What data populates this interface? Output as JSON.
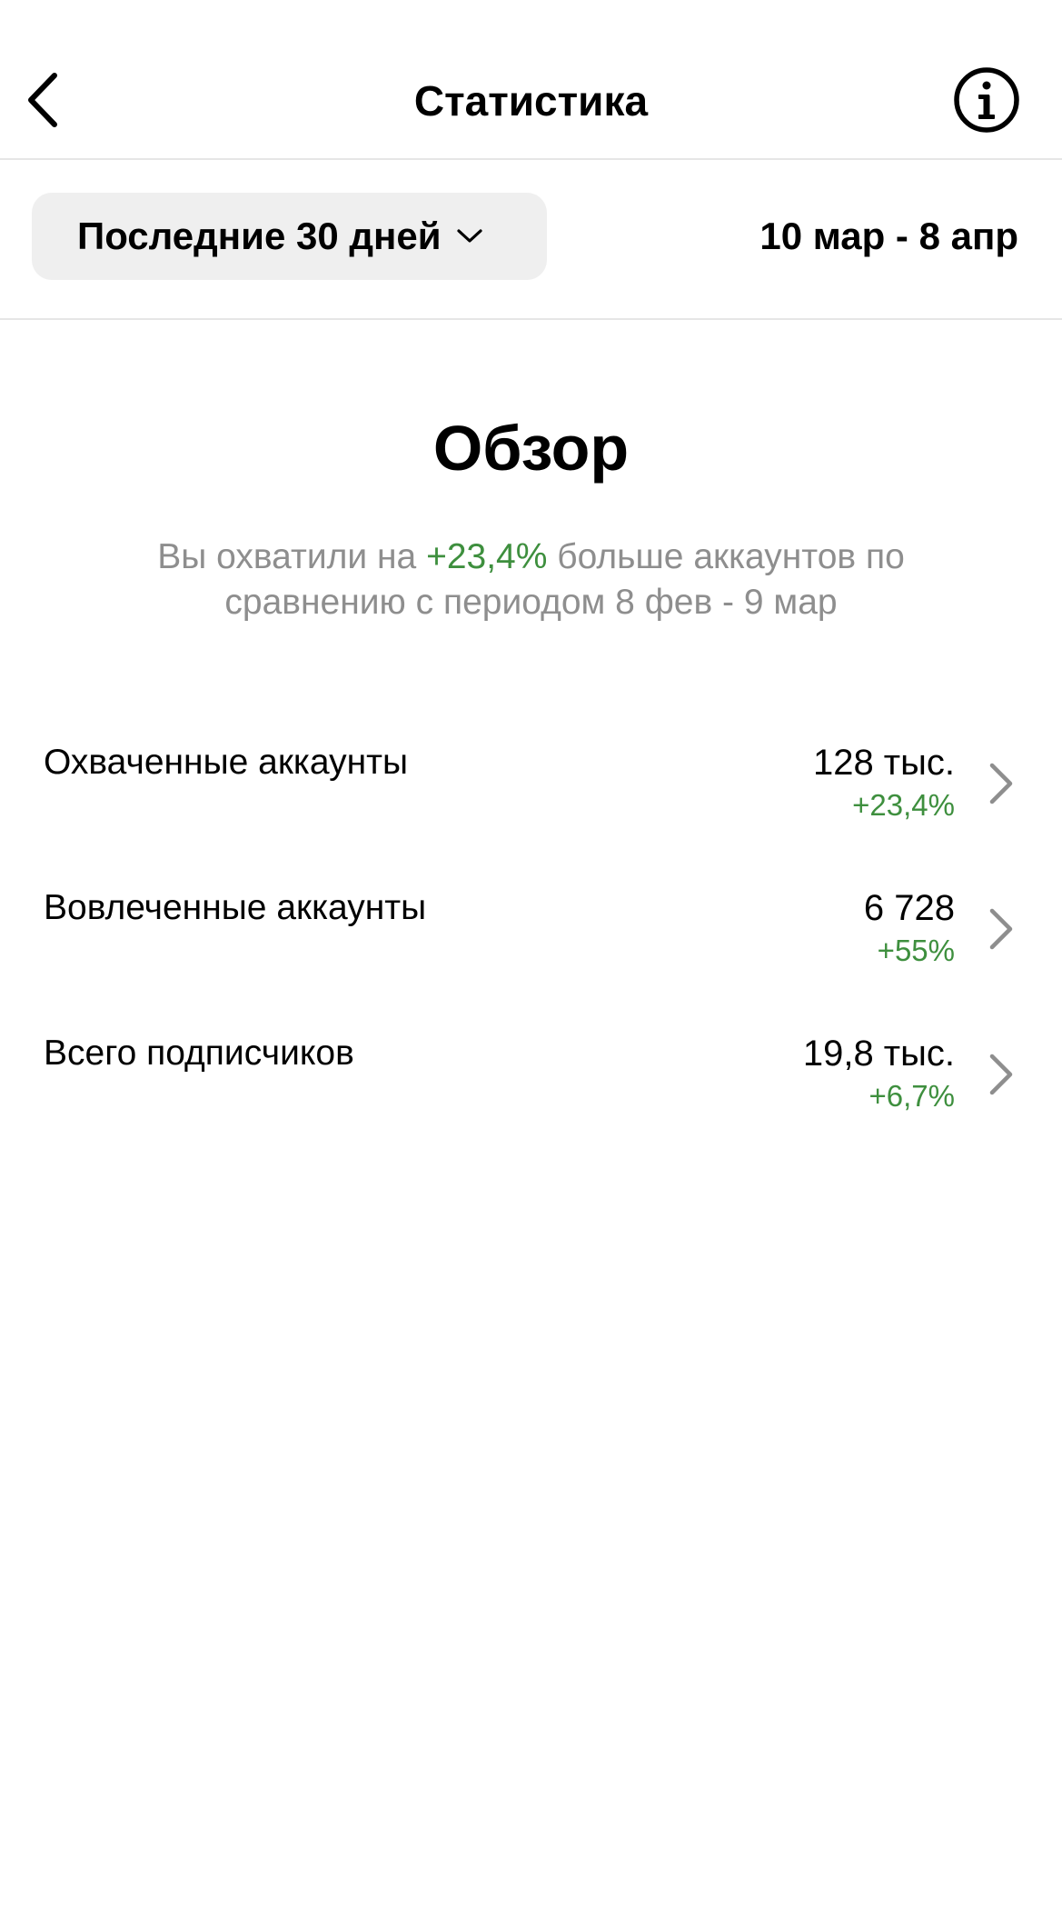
{
  "header": {
    "title": "Статистика",
    "back_icon": "chevron-left-icon",
    "info_icon": "info-icon"
  },
  "filter": {
    "period_label": "Последние 30 дней",
    "date_range": "10 мар - 8 апр"
  },
  "overview": {
    "title": "Обзор",
    "desc_prefix": "Вы охватили на ",
    "desc_highlight": "+23,4%",
    "desc_suffix": " больше аккаунтов по сравнению с периодом 8 фев - 9 мар"
  },
  "metrics": [
    {
      "label": "Охваченные аккаунты",
      "value": "128 тыс.",
      "change": "+23,4%"
    },
    {
      "label": "Вовлеченные аккаунты",
      "value": "6 728",
      "change": "+55%"
    },
    {
      "label": "Всего подписчиков",
      "value": "19,8 тыс.",
      "change": "+6,7%"
    }
  ],
  "colors": {
    "positive_change": "#3e8f3e",
    "secondary_text": "#8e8e8e",
    "select_bg": "#efefef",
    "divider": "#e6e6e6"
  }
}
